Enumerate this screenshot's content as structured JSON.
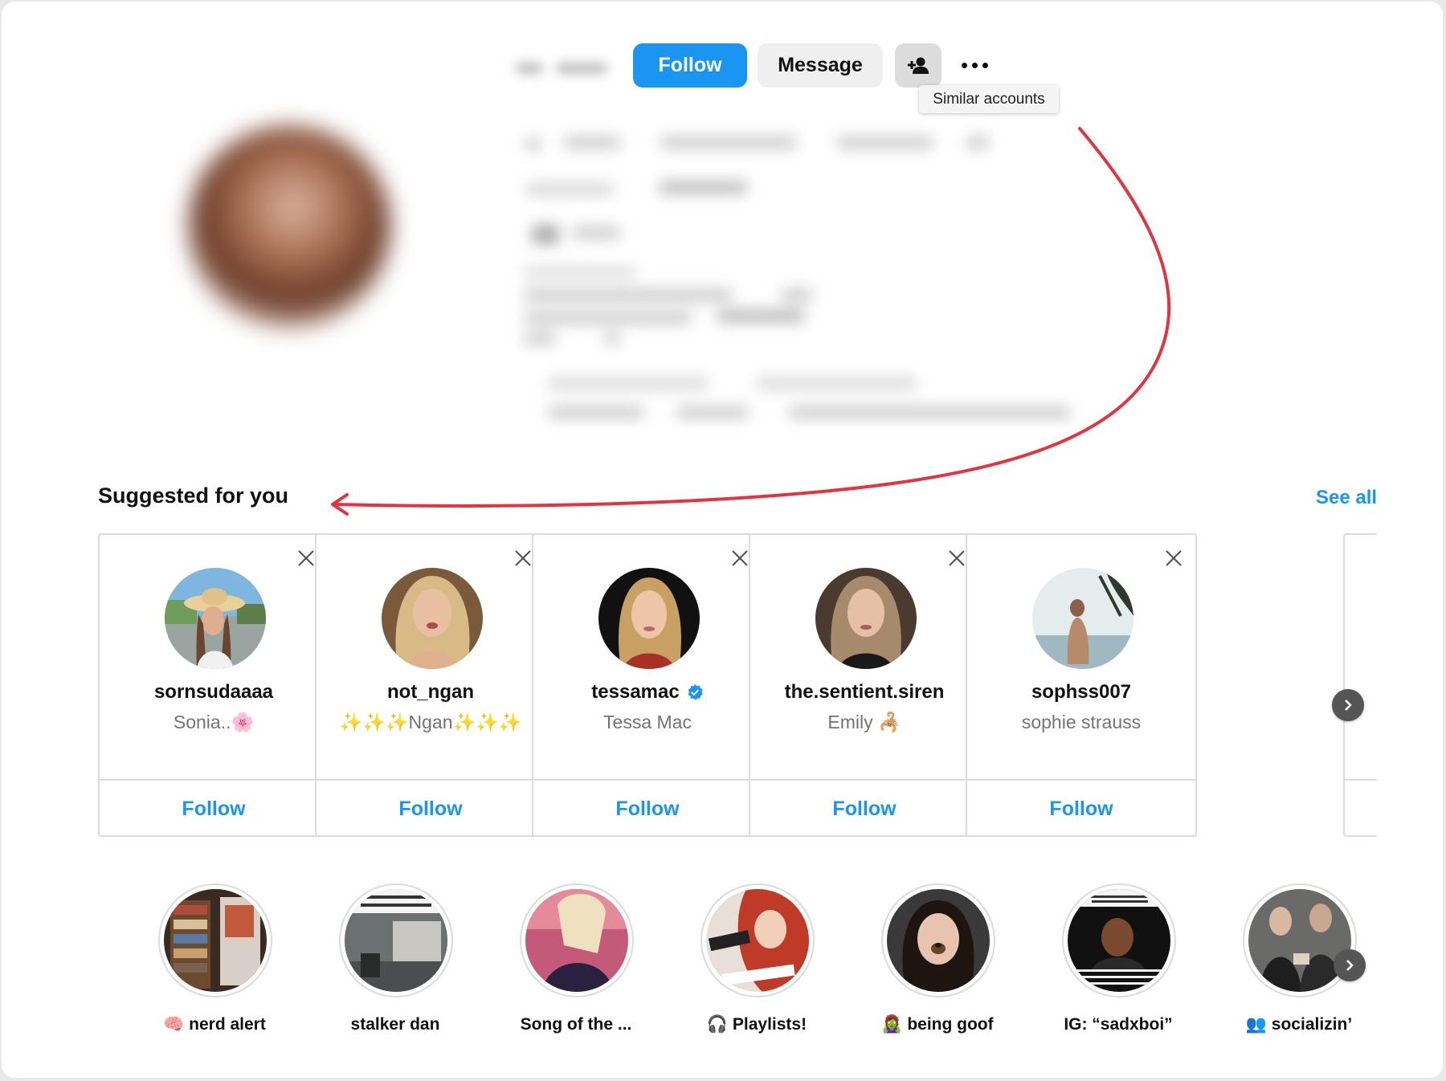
{
  "profile": {
    "follow_label": "Follow",
    "message_label": "Message",
    "similar_tooltip": "Similar accounts"
  },
  "suggested": {
    "title": "Suggested for you",
    "see_all": "See all",
    "accounts": [
      {
        "username": "sornsudaaaa",
        "name": "Sonia..🌸",
        "verified": false,
        "follow": "Follow"
      },
      {
        "username": "not_ngan",
        "name": "✨✨✨Ngan✨✨✨",
        "verified": false,
        "follow": "Follow"
      },
      {
        "username": "tessamac",
        "name": "Tessa Mac",
        "verified": true,
        "follow": "Follow"
      },
      {
        "username": "the.sentient.siren",
        "name": "Emily 🦂",
        "verified": false,
        "follow": "Follow"
      },
      {
        "username": "sophss007",
        "name": "sophie strauss",
        "verified": false,
        "follow": "Follow"
      }
    ]
  },
  "highlights": [
    {
      "label": "🧠 nerd alert"
    },
    {
      "label": "stalker dan"
    },
    {
      "label": "Song of the ..."
    },
    {
      "label": "🎧 Playlists!"
    },
    {
      "label": "🧟‍♀️ being goof"
    },
    {
      "label": "IG: “sadxboi”"
    },
    {
      "label": "👥 socializin’"
    }
  ],
  "colors": {
    "accent": "#1a95f2",
    "arrow": "#e8313f",
    "verified": "#1a95f2"
  }
}
